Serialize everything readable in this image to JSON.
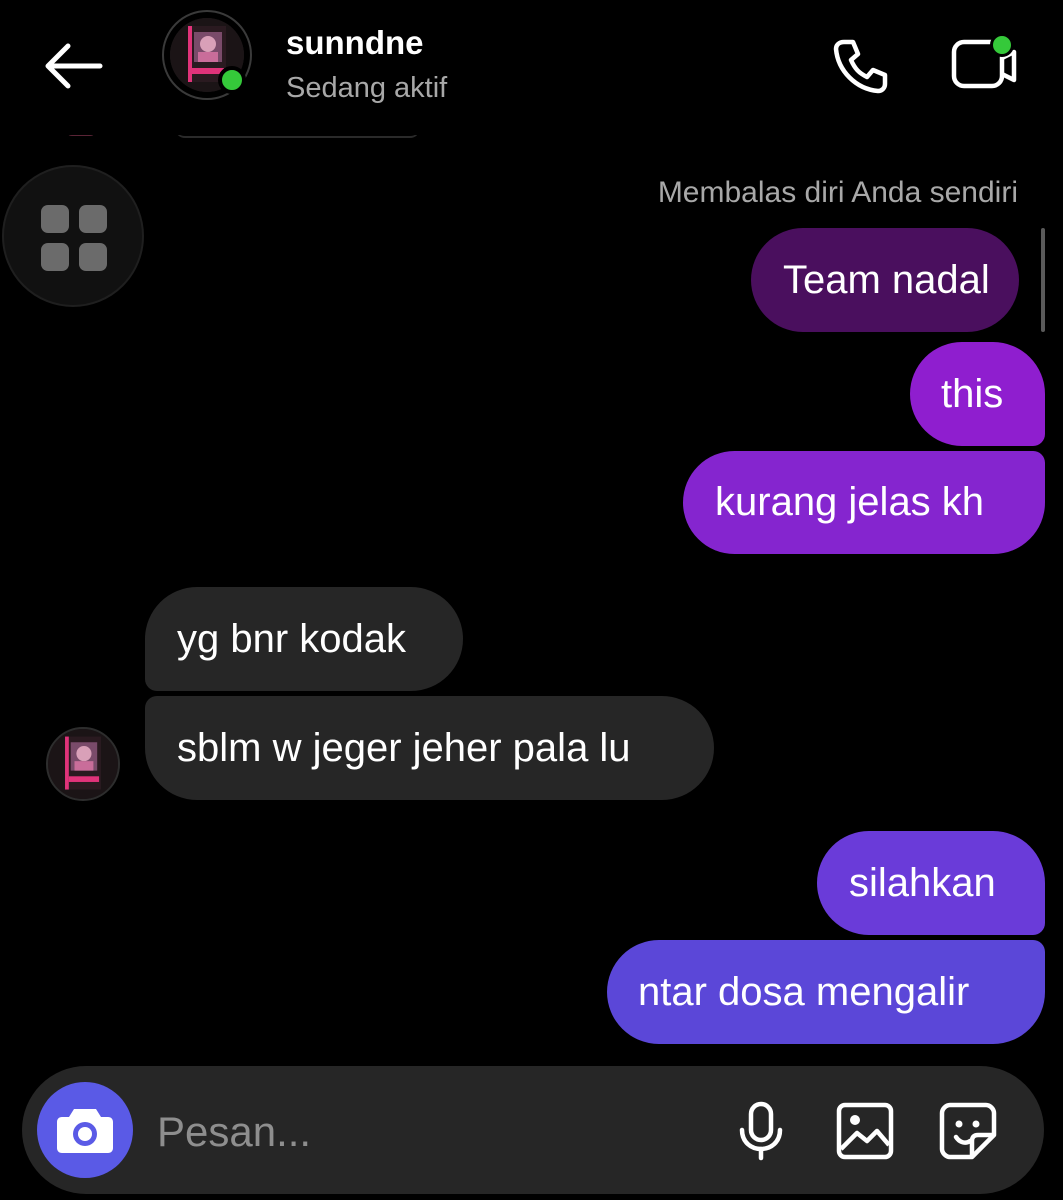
{
  "header": {
    "username": "sunndne",
    "status": "Sedang aktif"
  },
  "thread": {
    "reply_label": "Membalas diri Anda sendiri",
    "messages": [
      {
        "from": "me",
        "text": "Team nadal"
      },
      {
        "from": "me",
        "text": "this"
      },
      {
        "from": "me",
        "text": "kurang jelas kh"
      },
      {
        "from": "them",
        "text": "yg bnr kodak"
      },
      {
        "from": "them",
        "text": "sblm w jeger jeher pala lu"
      },
      {
        "from": "me",
        "text": "silahkan"
      },
      {
        "from": "me",
        "text": "ntar dosa mengalir"
      }
    ]
  },
  "composer": {
    "placeholder": "Pesan..."
  },
  "colors": {
    "background": "#000000",
    "received_bubble": "#262626",
    "reply_bubble": "#4a0f5e",
    "sent_gradient_top": "#8d1fd1",
    "sent_gradient_bottom": "#5b4ad8",
    "online": "#35c93a",
    "camera_button": "#5a5ae6"
  },
  "icons": [
    "back-arrow-icon",
    "phone-icon",
    "video-call-icon",
    "grid-icon",
    "camera-icon",
    "microphone-icon",
    "gallery-icon",
    "sticker-icon"
  ]
}
